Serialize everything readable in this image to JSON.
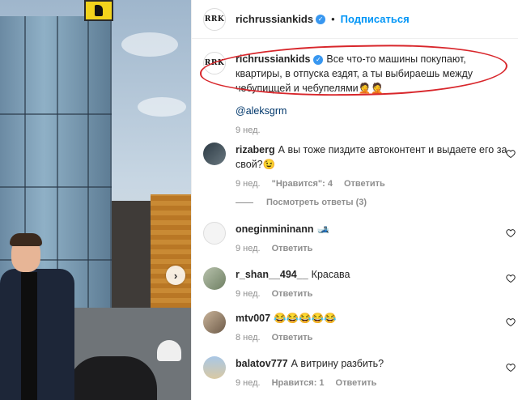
{
  "post": {
    "author": "richrussiankids",
    "avatar_text": "RRK",
    "follow_label": "Подписаться",
    "caption_text": "Все что-то машины покупают, квартиры, в отпуска ездят, а ты выбираешь между чебупиццей и чебупелями🤦🤦",
    "mention": "@aleksgrm",
    "time": "9 нед."
  },
  "comments": [
    {
      "username": "rizaberg",
      "text": "А вы тоже пиздите автоконтент и выдаете его за свой?😉",
      "time": "9 нед.",
      "likes": "\"Нравится\": 4",
      "reply_label": "Ответить",
      "view_replies": "Посмотреть ответы (3)"
    },
    {
      "username": "oneginmininann",
      "text": "🎿",
      "time": "9 нед.",
      "reply_label": "Ответить"
    },
    {
      "username": "r_shan__494__",
      "text": "Красава",
      "time": "9 нед.",
      "reply_label": "Ответить"
    },
    {
      "username": "mtv007",
      "text": "😂😂😂😂😂",
      "time": "8 нед.",
      "reply_label": "Ответить"
    },
    {
      "username": "balatov777",
      "text": "А витрину разбить?",
      "time": "9 нед.",
      "likes": "Нравится: 1",
      "reply_label": "Ответить"
    }
  ],
  "colors": {
    "accent": "#0095f6",
    "verified": "#3897f0",
    "annotation": "#d8262b"
  }
}
